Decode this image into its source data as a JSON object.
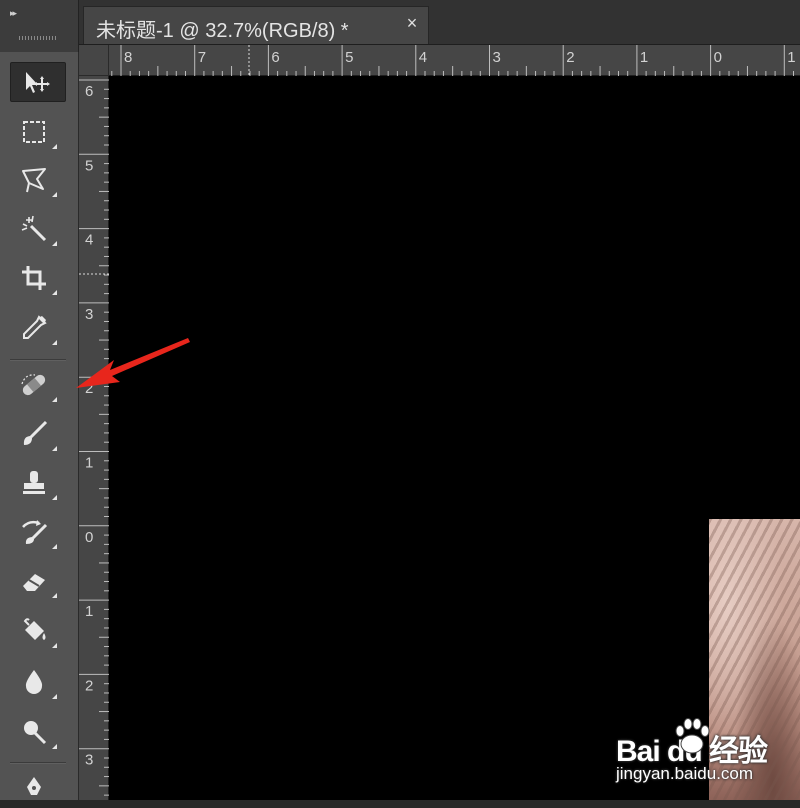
{
  "document_tab": {
    "title": "未标题-1 @ 32.7%(RGB/8) *",
    "close_glyph": "×"
  },
  "toolbar": {
    "collapse_glyph": "▸▸",
    "tools": [
      {
        "name": "move-tool",
        "icon": "move-icon",
        "active": true
      },
      {
        "name": "rectangular-marquee-tool",
        "icon": "marquee-icon"
      },
      {
        "name": "lasso-tool",
        "icon": "polygonal-lasso-icon"
      },
      {
        "name": "magic-wand-tool",
        "icon": "magic-wand-icon"
      },
      {
        "name": "crop-tool",
        "icon": "crop-icon"
      },
      {
        "name": "eyedropper-tool",
        "icon": "eyedropper-icon"
      },
      {
        "name": "spot-healing-brush-tool",
        "icon": "bandage-icon"
      },
      {
        "name": "brush-tool",
        "icon": "brush-icon"
      },
      {
        "name": "clone-stamp-tool",
        "icon": "stamp-icon"
      },
      {
        "name": "history-brush-tool",
        "icon": "history-brush-icon"
      },
      {
        "name": "eraser-tool",
        "icon": "eraser-icon"
      },
      {
        "name": "paint-bucket-tool",
        "icon": "paint-bucket-icon"
      },
      {
        "name": "blur-tool",
        "icon": "drop-icon"
      },
      {
        "name": "dodge-tool",
        "icon": "dodge-icon"
      },
      {
        "name": "pen-tool",
        "icon": "pen-icon"
      }
    ]
  },
  "ruler_top": {
    "labels": [
      "8",
      "7",
      "6",
      "5",
      "4",
      "3",
      "2",
      "1",
      "0",
      "1"
    ]
  },
  "ruler_left": {
    "labels": [
      "6",
      "5",
      "4",
      "3",
      "2",
      "1",
      "0",
      "1",
      "2",
      "3"
    ]
  },
  "annotation": {
    "color": "#e8261c"
  },
  "watermark": {
    "brand": "Bai  du 经验",
    "site": "jingyan.baidu.com"
  },
  "colors": {
    "panel": "#535353",
    "canvas": "#000000",
    "ruler": "#464646",
    "tab_bar": "#323232"
  }
}
